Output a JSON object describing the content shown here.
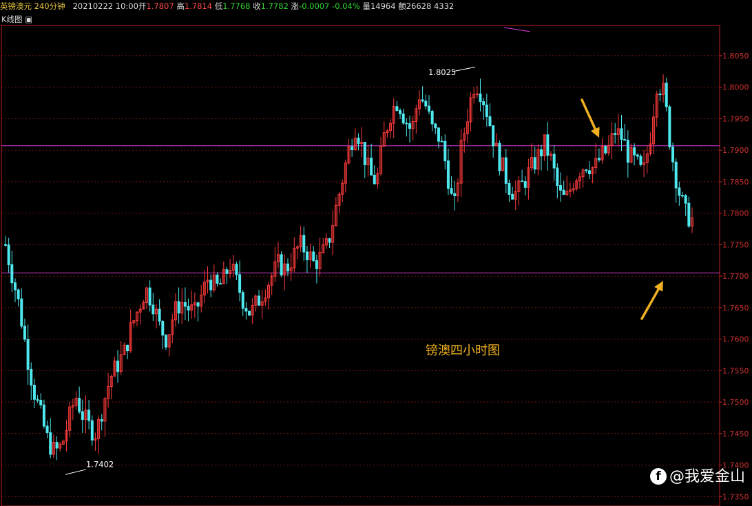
{
  "header": {
    "symbol": "英镑澳元",
    "period": "240分钟",
    "datetime": "20210222 10:00",
    "open_label": "开",
    "open": "1.7807",
    "high_label": "高",
    "high": "1.7814",
    "low_label": "低",
    "low": "1.7768",
    "close_label": "收",
    "close": "1.7782",
    "change_label": "涨",
    "change": "-0.0007",
    "change_pct": "-0.04%",
    "volume_label": "量",
    "volume": "14964",
    "amount_label": "额",
    "amount": "26628",
    "extra": "4332"
  },
  "subtitle": {
    "label": "K线图",
    "icon": "window-toggle-icon"
  },
  "watermark": {
    "icon": "toutiao-logo-icon",
    "text": "@我爱金山"
  },
  "colors": {
    "up": "#ff3b3b",
    "down": "#4ee8ee",
    "hline": "#e040e0",
    "grid": "#7a1515",
    "axis": "#c02020",
    "annotation": "#f0b020"
  },
  "chart_data": {
    "type": "candlestick",
    "title": "镑澳四小时图",
    "ylim": [
      1.7335,
      1.8098
    ],
    "yticks": [
      "1.8050",
      "1.8000",
      "1.7950",
      "1.7900",
      "1.7850",
      "1.7800",
      "1.7750",
      "1.7700",
      "1.7650",
      "1.7600",
      "1.7550",
      "1.7500",
      "1.7450",
      "1.7400",
      "1.7350"
    ],
    "horizontal_lines": [
      1.7907,
      1.7705
    ],
    "annotations": [
      {
        "label": "1.7402",
        "at_price": 1.7402,
        "kind": "low"
      },
      {
        "label": "1.8025",
        "at_price": 1.8025,
        "kind": "high"
      }
    ],
    "arrows": [
      {
        "direction": "down-right",
        "target": "resistance-line"
      },
      {
        "direction": "up-right",
        "target": "support-line"
      }
    ],
    "close_path": [
      1.775,
      1.77,
      1.765,
      1.758,
      1.752,
      1.748,
      1.744,
      1.742,
      1.743,
      1.747,
      1.751,
      1.748,
      1.746,
      1.745,
      1.75,
      1.754,
      1.756,
      1.758,
      1.762,
      1.765,
      1.768,
      1.766,
      1.762,
      1.76,
      1.764,
      1.766,
      1.765,
      1.764,
      1.767,
      1.77,
      1.768,
      1.769,
      1.772,
      1.769,
      1.766,
      1.764,
      1.766,
      1.768,
      1.77,
      1.772,
      1.771,
      1.773,
      1.775,
      1.774,
      1.772,
      1.773,
      1.775,
      1.78,
      1.785,
      1.79,
      1.794,
      1.79,
      1.786,
      1.785,
      1.792,
      1.796,
      1.798,
      1.795,
      1.793,
      1.799,
      1.797,
      1.793,
      1.792,
      1.787,
      1.78,
      1.79,
      1.796,
      1.801,
      1.799,
      1.795,
      1.79,
      1.787,
      1.784,
      1.783,
      1.785,
      1.787,
      1.789,
      1.791,
      1.788,
      1.783,
      1.782,
      1.785,
      1.787,
      1.788,
      1.787,
      1.789,
      1.79,
      1.793,
      1.792,
      1.789,
      1.788,
      1.786,
      1.792,
      1.801,
      1.799,
      1.79,
      1.784,
      1.78,
      1.779
    ]
  }
}
